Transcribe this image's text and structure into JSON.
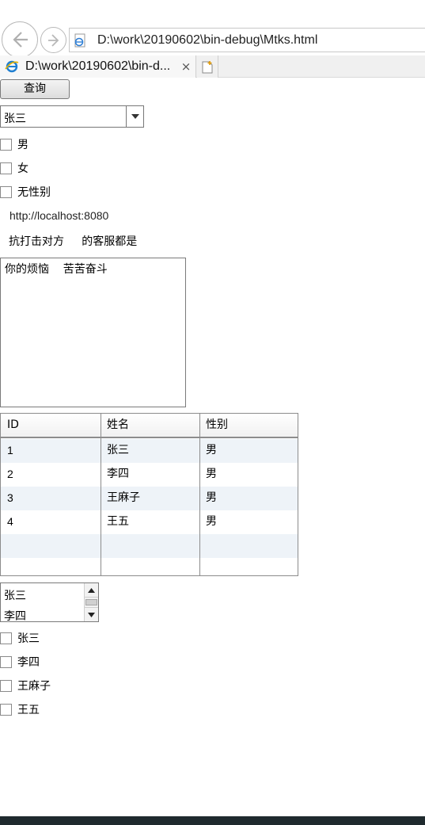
{
  "browser": {
    "address_url": "D:\\work\\20190602\\bin-debug\\Mtks.html",
    "tab_title": "D:\\work\\20190602\\bin-d...",
    "tab_close_glyph": "×",
    "icons": {
      "back": "back-arrow-icon",
      "forward": "forward-arrow-icon",
      "page": "ie-page-icon",
      "new_tab": "new-tab-icon"
    }
  },
  "form": {
    "query_button_label": "查询",
    "select_value": "张三",
    "gender_options": [
      "男",
      "女",
      "无性别"
    ],
    "url_label": "http://localhost:8080",
    "text_line": "抗打击对方     的客服都是",
    "textarea_value": "你的烦恼    苦苦奋斗"
  },
  "table": {
    "headers": [
      "ID",
      "姓名",
      "性别"
    ],
    "rows": [
      [
        "1",
        "张三",
        "男"
      ],
      [
        "2",
        "李四",
        "男"
      ],
      [
        "3",
        "王麻子",
        "男"
      ],
      [
        "4",
        "王五",
        "男"
      ]
    ]
  },
  "listbox": {
    "options": [
      "张三",
      "李四"
    ]
  },
  "name_checkboxes": [
    "张三",
    "李四",
    "王麻子",
    "王五"
  ],
  "colors": {
    "row_alt": "#eef3f8",
    "border": "#8c8c8c",
    "bottom_bar": "#1f2a2e"
  }
}
